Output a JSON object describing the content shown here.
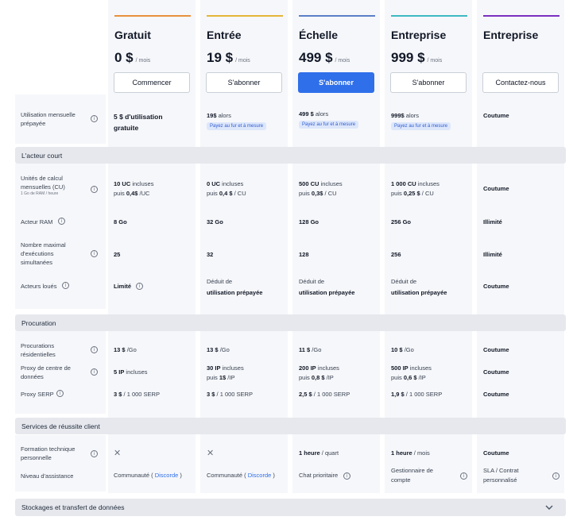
{
  "plans": [
    {
      "name": "Gratuit",
      "price": "0 $",
      "per": "/ mois",
      "button": "Commencer",
      "accent": "#e8903d",
      "primary": false
    },
    {
      "name": "Entrée",
      "price": "19 $",
      "per": "/ mois",
      "button": "S'abonner",
      "accent": "#e5b53a",
      "primary": false
    },
    {
      "name": "Échelle",
      "price": "499 $",
      "per": "/ mois",
      "button": "S'abonner",
      "accent": "#5b7fc8",
      "primary": true
    },
    {
      "name": "Entreprise",
      "price": "999 $",
      "per": "/ mois",
      "button": "S'abonner",
      "accent": "#3fb9c2",
      "primary": false
    },
    {
      "name": "Entreprise",
      "price": "",
      "per": "",
      "button": "Contactez-nous",
      "accent": "#7b2fbf",
      "primary": false
    }
  ],
  "usage": {
    "label": "Utilisation mensuelle prépayée",
    "cells": [
      {
        "main": "5 $ d'utilisation gratuite"
      },
      {
        "main": "19$",
        "rest": " alors",
        "badge": "Payez au fur et à mesure"
      },
      {
        "main": "499 $",
        "rest": " alors",
        "badge": "Payez au fur et à mesure"
      },
      {
        "main": "999$",
        "rest": " alors",
        "badge": "Payez au fur et à mesure"
      },
      {
        "main": "Coutume"
      }
    ]
  },
  "sections": {
    "actor": "L'acteur court",
    "proxy": "Procuration",
    "services": "Services de réussite client",
    "storage": "Stockages et transfert de données"
  },
  "actor_rows": {
    "cu": {
      "label": "Unités de calcul mensuelles (CU)",
      "sub": "1 Go de RAM / heure",
      "cells": [
        {
          "b1": "10 UC",
          "t1": " incluses",
          "t2": "puis ",
          "b2": "0,4$",
          "t3": " /UC"
        },
        {
          "b1": "0 UC",
          "t1": " incluses",
          "t2": "puis ",
          "b2": "0,4 $",
          "t3": " / CU"
        },
        {
          "b1": "500 CU",
          "t1": " incluses",
          "t2": "puis ",
          "b2": "0,3$",
          "t3": " / CU"
        },
        {
          "b1": "1 000 CU",
          "t1": " incluses",
          "t2": "puis ",
          "b2": "0,25 $",
          "t3": " / CU"
        },
        {
          "b1": "Coutume"
        }
      ]
    },
    "ram": {
      "label": "Acteur RAM",
      "cells": [
        "8 Go",
        "32 Go",
        "128 Go",
        "256 Go",
        "Illimité"
      ]
    },
    "runs": {
      "label": "Nombre maximal d'exécutions simultanées",
      "cells": [
        "25",
        "32",
        "128",
        "256",
        "Illimité"
      ]
    },
    "rented": {
      "label": "Acteurs loués",
      "limited": "Limité",
      "deduct1": "Déduit de",
      "deduct2": "utilisation prépayée",
      "custom": "Coutume"
    }
  },
  "proxy_rows": {
    "residential": {
      "label": "Procurations résidentielles",
      "cells": [
        {
          "b": "13 $",
          "t": " /Go"
        },
        {
          "b": "13 $",
          "t": " /Go"
        },
        {
          "b": "11 $",
          "t": " /Go"
        },
        {
          "b": "10 $",
          "t": " /Go"
        },
        {
          "b": "Coutume",
          "t": ""
        }
      ]
    },
    "datacenter": {
      "label": "Proxy de centre de données",
      "cells": [
        {
          "b1": "5 IP",
          "t1": " incluses"
        },
        {
          "b1": "30 IP",
          "t1": " incluses",
          "t2": "puis ",
          "b2": "1$",
          "t3": " /IP"
        },
        {
          "b1": "200 IP",
          "t1": " incluses",
          "t2": "puis ",
          "b2": "0,8 $",
          "t3": " /IP"
        },
        {
          "b1": "500 IP",
          "t1": " incluses",
          "t2": "puis ",
          "b2": "0,6 $",
          "t3": " /IP"
        },
        {
          "b1": "Coutume"
        }
      ]
    },
    "serp": {
      "label": "Proxy SERP",
      "cells": [
        {
          "b": "3 $",
          "t": " / 1 000 SERP"
        },
        {
          "b": "3 $",
          "t": " / 1 000 SERP"
        },
        {
          "b": "2,5 $",
          "t": " / 1 000 SERP"
        },
        {
          "b": "1,9 $",
          "t": " / 1 000 SERP"
        },
        {
          "b": "Coutume",
          "t": ""
        }
      ]
    }
  },
  "service_rows": {
    "training": {
      "label": "Formation technique personnelle",
      "cells": [
        {
          "x": true
        },
        {
          "x": true
        },
        {
          "b": "1 heure",
          "t": " / quart"
        },
        {
          "b": "1 heure",
          "t": " / mois"
        },
        {
          "b": "Coutume",
          "t": ""
        }
      ]
    },
    "support": {
      "label": "Niveau d'assistance",
      "community": "Communauté (",
      "discord": "Discorde",
      "close": ")",
      "priority": "Chat prioritaire",
      "manager1": "Gestionnaire de",
      "manager2": "compte",
      "sla1": "SLA / Contrat",
      "sla2": "personnalisé"
    }
  }
}
